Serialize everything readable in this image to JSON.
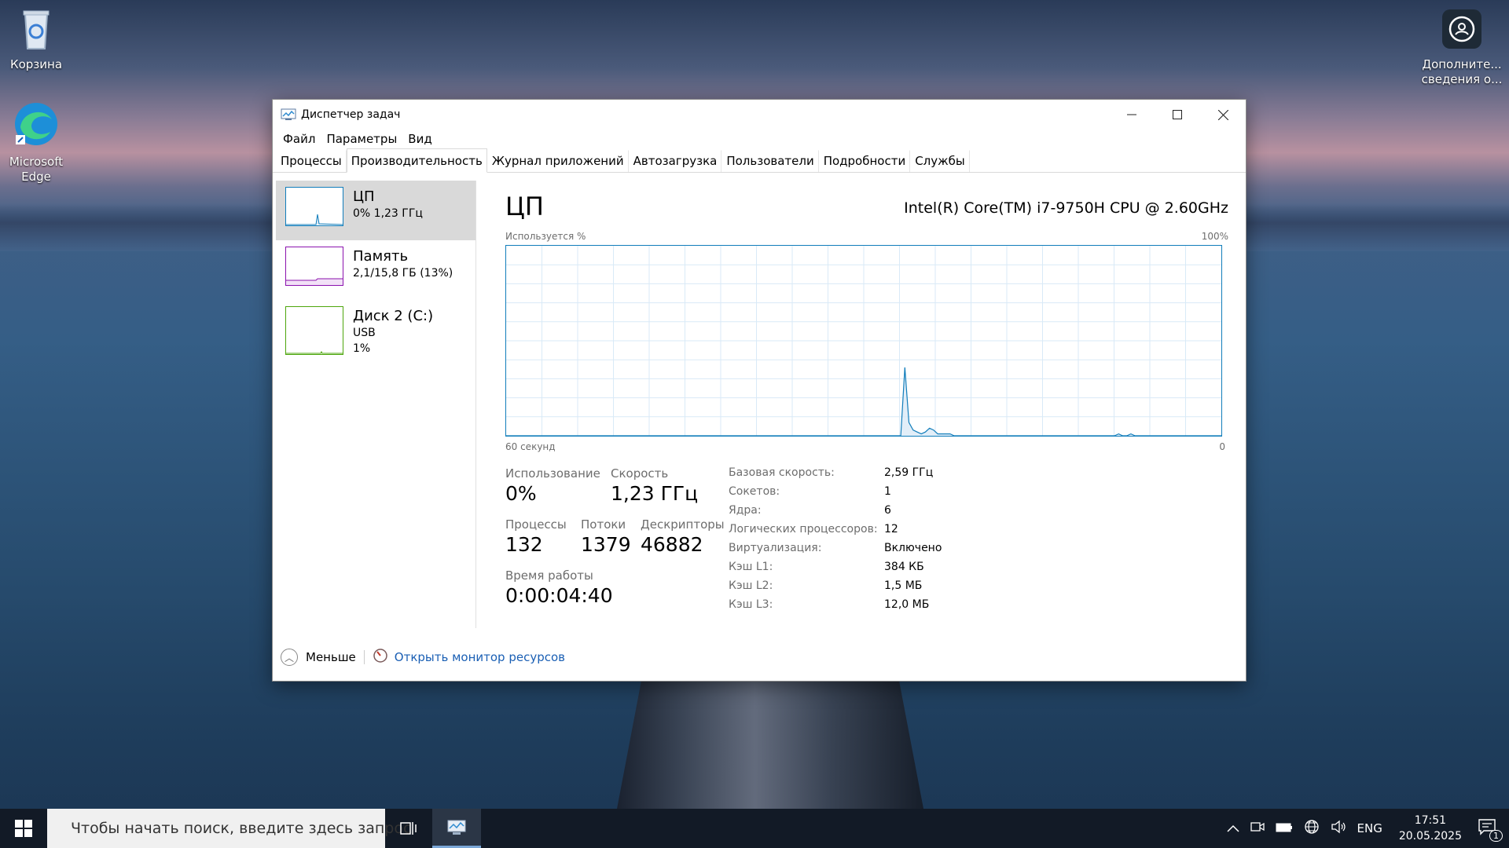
{
  "desktop": {
    "icons": [
      {
        "label": "Корзина"
      },
      {
        "label": "Microsoft Edge"
      },
      {
        "label": "Дополните... сведения о..."
      }
    ]
  },
  "window": {
    "title": "Диспетчер задач",
    "controls": {
      "minimize": "—",
      "maximize": "☐",
      "close": "✕"
    },
    "menu": [
      "Файл",
      "Параметры",
      "Вид"
    ],
    "tabs": [
      "Процессы",
      "Производительность",
      "Журнал приложений",
      "Автозагрузка",
      "Пользователи",
      "Подробности",
      "Службы"
    ],
    "active_tab": "Производительность"
  },
  "sidebar": {
    "items": [
      {
        "title": "ЦП",
        "sub1": "0%  1,23 ГГц",
        "sub2": "",
        "color": "#117dbb"
      },
      {
        "title": "Память",
        "sub1": "2,1/15,8 ГБ (13%)",
        "sub2": "",
        "color": "#8b12ae"
      },
      {
        "title": "Диск 2 (C:)",
        "sub1": "USB",
        "sub2": "1%",
        "color": "#4da60c"
      }
    ]
  },
  "cpu": {
    "title": "ЦП",
    "model": "Intel(R) Core(TM) i7-9750H CPU @ 2.60GHz",
    "graph_label_left": "Используется %",
    "graph_label_right": "100%",
    "time_left": "60 секунд",
    "time_right": "0",
    "stats": {
      "usage_label": "Использование",
      "usage_value": "0%",
      "speed_label": "Скорость",
      "speed_value": "1,23 ГГц",
      "processes_label": "Процессы",
      "processes_value": "132",
      "threads_label": "Потоки",
      "threads_value": "1379",
      "handles_label": "Дескрипторы",
      "handles_value": "46882",
      "uptime_label": "Время работы",
      "uptime_value": "0:00:04:40"
    },
    "specs": [
      {
        "label": "Базовая скорость:",
        "value": "2,59 ГГц"
      },
      {
        "label": "Сокетов:",
        "value": "1"
      },
      {
        "label": "Ядра:",
        "value": "6"
      },
      {
        "label": "Логических процессоров:",
        "value": "12"
      },
      {
        "label": "Виртуализация:",
        "value": "Включено"
      },
      {
        "label": "Кэш L1:",
        "value": "384 КБ"
      },
      {
        "label": "Кэш L2:",
        "value": "1,5 МБ"
      },
      {
        "label": "Кэш L3:",
        "value": "12,0 МБ"
      }
    ],
    "series": [
      0,
      0,
      0,
      0,
      0,
      0,
      0,
      0,
      0,
      0,
      0,
      0,
      0,
      0,
      0,
      0,
      0,
      0,
      0,
      0,
      0,
      0,
      0,
      0,
      0,
      0,
      0,
      0,
      0,
      0,
      0,
      0,
      0,
      0,
      0,
      0,
      0,
      0,
      0,
      0,
      0,
      0,
      0,
      0,
      0,
      0,
      0,
      0,
      0,
      0,
      0,
      0,
      0,
      0,
      0,
      0,
      0,
      0,
      0,
      0,
      0,
      0,
      0,
      0,
      0,
      0,
      0,
      0,
      0,
      0,
      0,
      0,
      0,
      0,
      0,
      0,
      0,
      0,
      0,
      0,
      0,
      0,
      0,
      0,
      0,
      0,
      0,
      0,
      0,
      0,
      0,
      0,
      0,
      0,
      0,
      0,
      0,
      36,
      7,
      3,
      2,
      1,
      2,
      4,
      3,
      1,
      1,
      1,
      1,
      0,
      0,
      0,
      0,
      0,
      0,
      0,
      0,
      0,
      0,
      0,
      0,
      0,
      0,
      0,
      0,
      0,
      0,
      0,
      0,
      0,
      0,
      0,
      0,
      0,
      0,
      0,
      0,
      0,
      0,
      0,
      0,
      0,
      0,
      0,
      0,
      0,
      0,
      0,
      0,
      1,
      0,
      0,
      1,
      0,
      0,
      0,
      0,
      0,
      0,
      0,
      0,
      0,
      0,
      0,
      0,
      0,
      0,
      0,
      0,
      0,
      0,
      0,
      0,
      0,
      0
    ],
    "graph_color": "#117dbb"
  },
  "footer": {
    "less_label": "Меньше",
    "monitor_link": "Открыть монитор ресурсов"
  },
  "taskbar": {
    "search_placeholder": "Чтобы начать поиск, введите здесь запрос",
    "language": "ENG",
    "time": "17:51",
    "date": "20.05.2025",
    "notifications": "1"
  }
}
